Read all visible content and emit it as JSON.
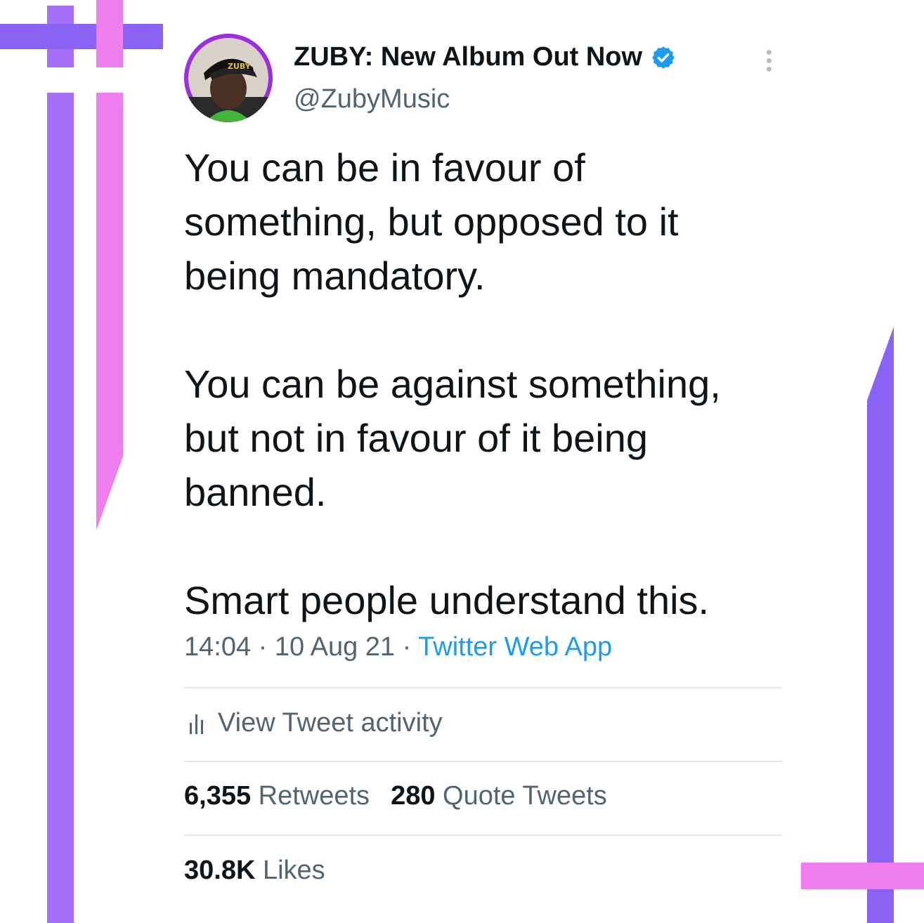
{
  "author": {
    "display_name": "ZUBY: New Album Out Now",
    "handle": "@ZubyMusic",
    "verified": true,
    "avatar_cap_text": "ZUBY"
  },
  "tweet": {
    "paragraphs": [
      "You can be in favour of\nsomething, but opposed to it\nbeing mandatory.",
      "You can be against something,\nbut not in favour of it being\nbanned.",
      "Smart people understand this."
    ]
  },
  "meta": {
    "time": "14:04",
    "separator": " · ",
    "date": "10 Aug 21",
    "app": "Twitter Web App"
  },
  "activity": {
    "label": "View Tweet activity"
  },
  "stats": {
    "retweets_count": "6,355",
    "retweets_label": "Retweets",
    "quotes_count": "280",
    "quotes_label": "Quote Tweets",
    "likes_count": "30.8K",
    "likes_label": "Likes"
  },
  "colors": {
    "accent_blue": "#1d9bf0",
    "deco_purple": "#a66ef5",
    "deco_pink": "#f07ef0",
    "deco_violet": "#8a63f5"
  }
}
